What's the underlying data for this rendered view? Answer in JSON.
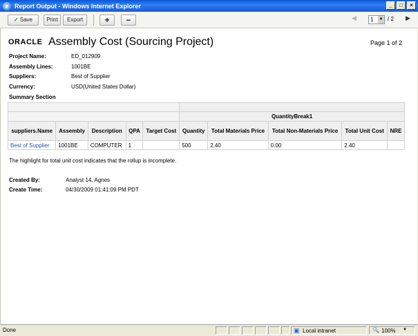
{
  "window": {
    "title": "Report Output - Windows Internet Explorer",
    "controls": [
      "_",
      "□",
      "×"
    ]
  },
  "toolbar": {
    "save_label": "Save",
    "print_label": "Print",
    "export_label": "Export",
    "plus_label": "+",
    "minus_label": "−",
    "page_value": "1",
    "page_total": "/ 2",
    "prev": "◀",
    "next": "▶"
  },
  "report": {
    "logo": "ORACLE",
    "title": "Assembly Cost (Sourcing Project)",
    "page_of": "Page 1 of 2",
    "fields": [
      {
        "label": "Project Name:",
        "value": "ED_012909"
      },
      {
        "label": "Assembly Lines:",
        "value": "1001BE"
      },
      {
        "label": "Suppliers:",
        "value": "Best of Supplier"
      },
      {
        "label": "Currency:",
        "value": "USD(United States Dollar)"
      }
    ],
    "summary_label": "Summary Section",
    "group_header": "QuantityBreak1",
    "columns": [
      "suppliers.Name",
      "Assembly",
      "Description",
      "QPA",
      "Target Cost",
      "Quantity",
      "Total Materials Price",
      "Total Non-Materials Price",
      "Total Unit Cost",
      "NRE"
    ],
    "rows": [
      [
        "Best of Supplier",
        "1001BE",
        "COMPUTER",
        "1",
        "",
        "500",
        "2.40",
        "0.00",
        "2.40",
        ""
      ]
    ],
    "note": "The highlight for total unit cost indicates that the rollup is incomplete.",
    "created_by_label": "Created By:",
    "created_by": "Analyst 14, Agnes",
    "create_time_label": "Create Time:",
    "create_time": "04/30/2009 01:41:09 PM PDT"
  },
  "status": {
    "text": "Done",
    "zone": "Local intranet",
    "zoom": "100%"
  }
}
